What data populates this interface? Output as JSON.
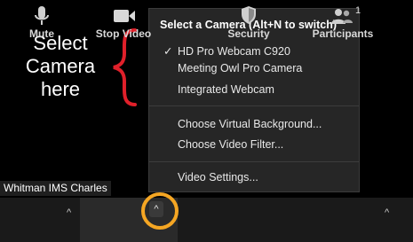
{
  "annotation": {
    "lines": [
      "Select",
      "Camera",
      "here"
    ],
    "brace_color": "#e0202a"
  },
  "participant": {
    "name": "Whitman IMS Charles"
  },
  "toolbar": {
    "mute_label": "Mute",
    "stop_video_label": "Stop Video",
    "security_label": "Security",
    "participants_label": "Participants",
    "participants_count": "1",
    "caret": "^",
    "highlight_color": "#f5a623"
  },
  "camera_menu": {
    "title": "Select a Camera (Alt+N to switch)",
    "check_mark": "✓",
    "cameras": [
      {
        "label": "HD Pro Webcam C920",
        "selected": true
      },
      {
        "label": "Meeting Owl Pro Camera",
        "selected": false
      },
      {
        "label": "Integrated Webcam",
        "selected": false
      }
    ],
    "actions": [
      {
        "label": "Choose Virtual Background..."
      },
      {
        "label": "Choose Video Filter..."
      }
    ],
    "settings_label": "Video Settings..."
  }
}
